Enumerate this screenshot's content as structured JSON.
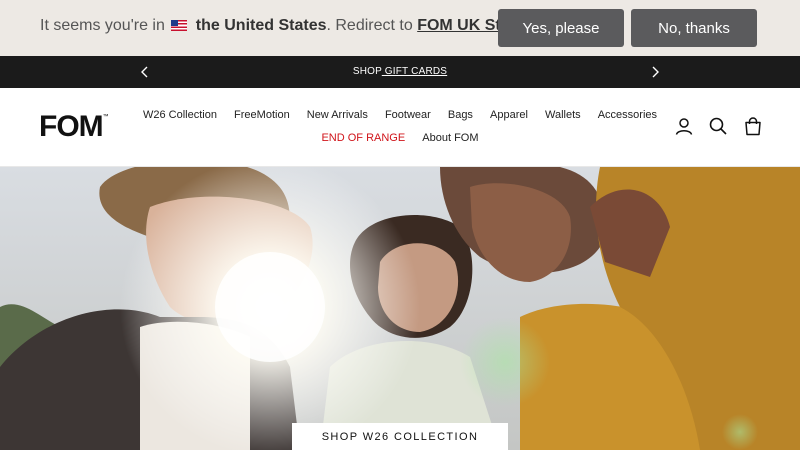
{
  "geo_banner": {
    "prefix": "It seems you're in",
    "country": "the United States",
    "middle": ". Redirect to ",
    "store_link": "FOM UK Store",
    "suffix": "?",
    "yes_label": "Yes, please",
    "no_label": "No, thanks",
    "flag_icon": "us-flag-icon"
  },
  "announcement": {
    "prefix": "SHOP",
    "link": " GIFT CARDS"
  },
  "header": {
    "logo": "FOM",
    "logo_mark": "™",
    "nav_primary": [
      "W26 Collection",
      "FreeMotion",
      "New Arrivals",
      "Footwear",
      "Bags",
      "Apparel",
      "Wallets",
      "Accessories"
    ],
    "nav_secondary": [
      "END OF RANGE",
      "About FOM"
    ],
    "sale_color": "#d0141a",
    "icons": [
      "account-icon",
      "search-icon",
      "cart-icon"
    ]
  },
  "hero": {
    "cta": "SHOP W26 COLLECTION"
  },
  "colors": {
    "banner_bg": "#ede9e4",
    "button_bg": "#5b5b5d",
    "announce_bg": "#1b1b1b"
  }
}
